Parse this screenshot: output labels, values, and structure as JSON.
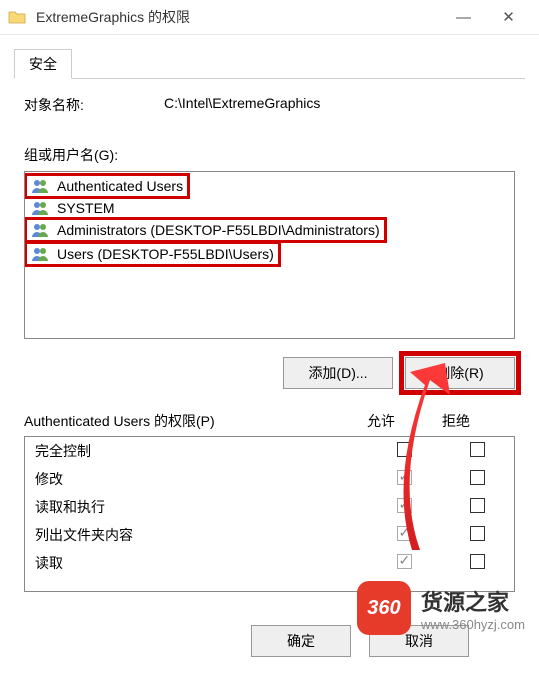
{
  "title_bar": {
    "title": "ExtremeGraphics 的权限"
  },
  "tab": {
    "label": "安全"
  },
  "object_name": {
    "label": "对象名称:",
    "value": "C:\\Intel\\ExtremeGraphics"
  },
  "group_users_label": "组或用户名(G):",
  "users": [
    {
      "name": "Authenticated Users",
      "highlight": true
    },
    {
      "name": "SYSTEM",
      "highlight": false
    },
    {
      "name": "Administrators (DESKTOP-F55LBDI\\Administrators)",
      "highlight": true
    },
    {
      "name": "Users (DESKTOP-F55LBDI\\Users)",
      "highlight": true
    }
  ],
  "buttons": {
    "add": "添加(D)...",
    "remove": "删除(R)",
    "ok": "确定",
    "cancel": "取消"
  },
  "permissions": {
    "title": "Authenticated Users 的权限(P)",
    "allow": "允许",
    "deny": "拒绝",
    "rows": [
      {
        "name": "完全控制",
        "allow": "unchecked",
        "deny": "unchecked"
      },
      {
        "name": "修改",
        "allow": "checked-disabled",
        "deny": "unchecked"
      },
      {
        "name": "读取和执行",
        "allow": "checked-disabled",
        "deny": "unchecked"
      },
      {
        "name": "列出文件夹内容",
        "allow": "checked-disabled",
        "deny": "unchecked"
      },
      {
        "name": "读取",
        "allow": "checked-disabled",
        "deny": "unchecked"
      }
    ]
  },
  "watermark": {
    "badge": "360",
    "line1": "货源之家",
    "line2": "www.360hyzj.com"
  }
}
